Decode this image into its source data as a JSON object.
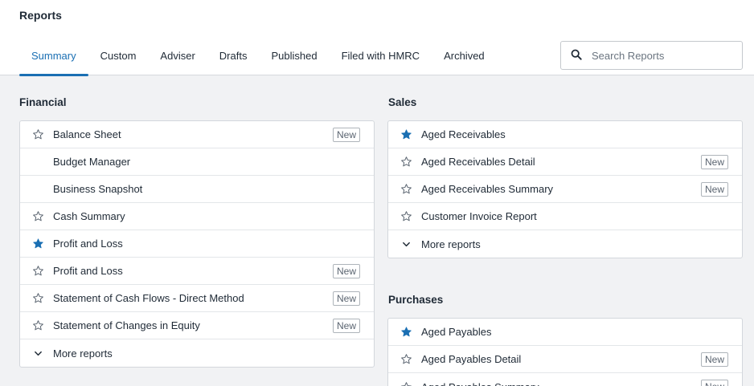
{
  "page": {
    "title": "Reports"
  },
  "tabs": [
    {
      "label": "Summary",
      "active": true
    },
    {
      "label": "Custom"
    },
    {
      "label": "Adviser"
    },
    {
      "label": "Drafts"
    },
    {
      "label": "Published"
    },
    {
      "label": "Filed with HMRC"
    },
    {
      "label": "Archived"
    }
  ],
  "search": {
    "placeholder": "Search Reports",
    "icon": "search-icon"
  },
  "colors": {
    "accent": "#1a6fb3",
    "star_filled": "#1a6fb3",
    "star_outline": "#5a6470"
  },
  "financial": {
    "title": "Financial",
    "items": [
      {
        "label": "Balance Sheet",
        "icon": "star-outline-icon",
        "badge": "New"
      },
      {
        "label": "Budget Manager",
        "icon": "none"
      },
      {
        "label": "Business Snapshot",
        "icon": "none"
      },
      {
        "label": "Cash Summary",
        "icon": "star-outline-icon"
      },
      {
        "label": "Profit and Loss",
        "icon": "star-filled-icon"
      },
      {
        "label": "Profit and Loss",
        "icon": "star-outline-icon",
        "badge": "New"
      },
      {
        "label": "Statement of Cash Flows - Direct Method",
        "icon": "star-outline-icon",
        "badge": "New"
      },
      {
        "label": "Statement of Changes in Equity",
        "icon": "star-outline-icon",
        "badge": "New"
      }
    ],
    "more": "More reports"
  },
  "sales": {
    "title": "Sales",
    "items": [
      {
        "label": "Aged Receivables",
        "icon": "star-filled-icon"
      },
      {
        "label": "Aged Receivables Detail",
        "icon": "star-outline-icon",
        "badge": "New"
      },
      {
        "label": "Aged Receivables Summary",
        "icon": "star-outline-icon",
        "badge": "New"
      },
      {
        "label": "Customer Invoice Report",
        "icon": "star-outline-icon"
      }
    ],
    "more": "More reports"
  },
  "purchases": {
    "title": "Purchases",
    "items": [
      {
        "label": "Aged Payables",
        "icon": "star-filled-icon"
      },
      {
        "label": "Aged Payables Detail",
        "icon": "star-outline-icon",
        "badge": "New"
      },
      {
        "label": "Aged Payables Summary",
        "icon": "star-outline-icon",
        "badge": "New"
      }
    ]
  }
}
